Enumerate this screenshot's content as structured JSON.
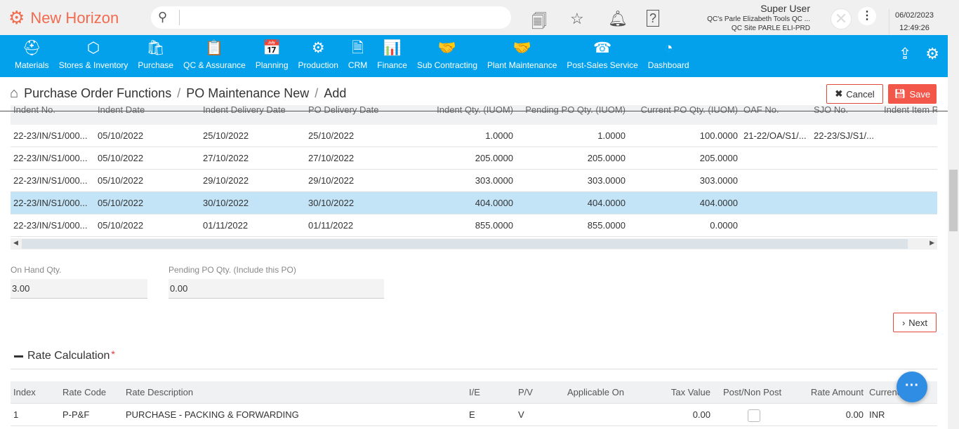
{
  "app": {
    "title": "New Horizon"
  },
  "search": {
    "placeholder": ""
  },
  "user": {
    "name": "Super User",
    "company": "QC's Parle Elizabeth Tools QC ...",
    "site": "QC Site PARLE ELI-PRD",
    "date": "06/02/2023",
    "time": "12:49:26"
  },
  "nav": [
    {
      "label": "Materials",
      "icon": "⛑"
    },
    {
      "label": "Stores & Inventory",
      "icon": "⬡"
    },
    {
      "label": "Purchase",
      "icon": "🛍"
    },
    {
      "label": "QC & Assurance",
      "icon": "📋"
    },
    {
      "label": "Planning",
      "icon": "📅"
    },
    {
      "label": "Production",
      "icon": "⚙"
    },
    {
      "label": "CRM",
      "icon": "🗎"
    },
    {
      "label": "Finance",
      "icon": "📊"
    },
    {
      "label": "Sub Contracting",
      "icon": "🤝"
    },
    {
      "label": "Plant Maintenance",
      "icon": "🤝"
    },
    {
      "label": "Post-Sales Service",
      "icon": "☎"
    },
    {
      "label": "Dashboard",
      "icon": "◔"
    }
  ],
  "breadcrumb": [
    "Purchase Order Functions",
    "PO Maintenance New",
    "Add"
  ],
  "buttons": {
    "cancel": "Cancel",
    "save": "Save",
    "next": "Next"
  },
  "indent_table": {
    "headers": [
      "Indent No.",
      "Indent Date",
      "Indent Delivery Date",
      "PO Delivery Date",
      "Indent Qty. (IUOM)",
      "Pending PO Qty. (IUOM)",
      "Current PO Qty. (IUOM)",
      "OAF No.",
      "SJO No.",
      "Indent Item R"
    ],
    "rows": [
      [
        "22-23/IN/S1/000...",
        "05/10/2022",
        "25/10/2022",
        "25/10/2022",
        "1.0000",
        "1.0000",
        "100.0000",
        "21-22/OA/S1/...",
        "22-23/SJ/S1/...",
        ""
      ],
      [
        "22-23/IN/S1/000...",
        "05/10/2022",
        "27/10/2022",
        "27/10/2022",
        "205.0000",
        "205.0000",
        "205.0000",
        "",
        "",
        ""
      ],
      [
        "22-23/IN/S1/000...",
        "05/10/2022",
        "29/10/2022",
        "29/10/2022",
        "303.0000",
        "303.0000",
        "303.0000",
        "",
        "",
        ""
      ],
      [
        "22-23/IN/S1/000...",
        "05/10/2022",
        "30/10/2022",
        "30/10/2022",
        "404.0000",
        "404.0000",
        "404.0000",
        "",
        "",
        ""
      ],
      [
        "22-23/IN/S1/000...",
        "05/10/2022",
        "01/11/2022",
        "01/11/2022",
        "855.0000",
        "855.0000",
        "0.0000",
        "",
        "",
        ""
      ]
    ]
  },
  "fields": {
    "on_hand_label": "On Hand Qty.",
    "on_hand_value": "3.00",
    "pending_label": "Pending PO Qty. (Include this PO)",
    "pending_value": "0.00"
  },
  "rate": {
    "title": "Rate Calculation",
    "required": "*",
    "headers": [
      "Index",
      "Rate Code",
      "Rate Description",
      "I/E",
      "P/V",
      "Applicable On",
      "Tax Value",
      "Post/Non Post",
      "Rate Amount",
      "Currency"
    ],
    "rows": [
      [
        "1",
        "P-P&F",
        "PURCHASE - PACKING & FORWARDING",
        "E",
        "V",
        "",
        "0.00",
        "",
        "0.00",
        "INR"
      ]
    ]
  },
  "colors": {
    "brand": "#f26b4f",
    "nav": "#03a1eb",
    "selected_row": "#c3e4f7",
    "save": "#f2574a"
  }
}
